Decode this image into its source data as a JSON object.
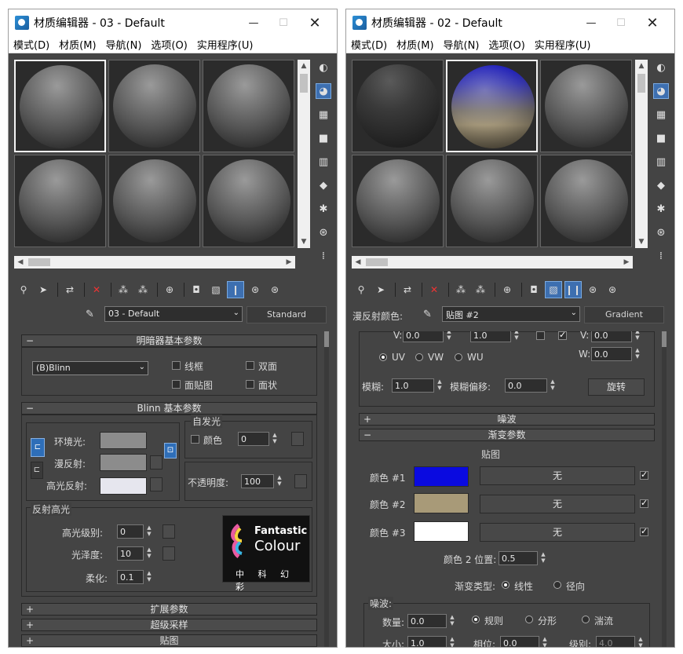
{
  "windows": [
    {
      "title": "材质编辑器 - 03 - Default",
      "menu": [
        "模式(D)",
        "材质(M)",
        "导航(N)",
        "选项(O)",
        "实用程序(U)"
      ],
      "name_label": "",
      "material_name": "03 - Default",
      "material_type": "Standard",
      "rollout_shader": "明暗器基本参数",
      "shader": "(B)Blinn",
      "check_wire": "线框",
      "check_2sided": "双面",
      "check_facemap": "面贴图",
      "check_faceted": "面状",
      "rollout_blinn": "Blinn 基本参数",
      "self_illum": "自发光",
      "color_label": "颜色",
      "self_illum_value": "0",
      "ambient": "环境光:",
      "diffuse": "漫反射:",
      "specular": "高光反射:",
      "opacity_label": "不透明度:",
      "opacity_value": "100",
      "spec_group": "反射高光",
      "spec_level_label": "高光级别:",
      "spec_level_value": "0",
      "gloss_label": "光泽度:",
      "gloss_value": "10",
      "soften_label": "柔化:",
      "soften_value": "0.1",
      "rollout_ext": "扩展参数",
      "rollout_ss": "超级采样",
      "rollout_maps": "贴图",
      "logo": {
        "line1": "Fantastic",
        "line2": "Colour",
        "line3": "中 科 幻 彩"
      }
    },
    {
      "title": "材质编辑器 - 02 - Default",
      "menu": [
        "模式(D)",
        "材质(M)",
        "导航(N)",
        "选项(O)",
        "实用程序(U)"
      ],
      "name_label": "漫反射颜色:",
      "material_name": "贴图 #2",
      "material_type": "Gradient",
      "v_label": "V:",
      "v_value": "0.0",
      "w_label": "W:",
      "w_value": "0.0",
      "v_row_val1": "0.0",
      "v_row_val2": "1.0",
      "uv": "UV",
      "vw": "VW",
      "wu": "WU",
      "blur_label": "模糊:",
      "blur_value": "1.0",
      "blur_offset_label": "模糊偏移:",
      "blur_offset_value": "0.0",
      "rotate": "旋转",
      "rollout_noise": "噪波",
      "rollout_gradient": "渐变参数",
      "maps_label": "贴图",
      "color1": "颜色 #1",
      "color2": "颜色 #2",
      "color3": "颜色 #3",
      "none": "无",
      "color2pos_label": "颜色 2 位置:",
      "color2pos_value": "0.5",
      "gradtype_label": "渐变类型:",
      "linear": "线性",
      "radial": "径向",
      "noise_group": "噪波:",
      "amount_label": "数量:",
      "amount_value": "0.0",
      "regular": "规则",
      "fractal": "分形",
      "turbulence": "湍流",
      "size_label": "大小:",
      "size_value": "1.0",
      "phase_label": "相位:",
      "phase_value": "0.0",
      "levels_label": "级别:",
      "levels_value": "4.0"
    }
  ],
  "colors": {
    "color1": "#0a0ae0",
    "color2": "#a89a78",
    "color3": "#ffffff",
    "accent": "#3d6fb0"
  }
}
